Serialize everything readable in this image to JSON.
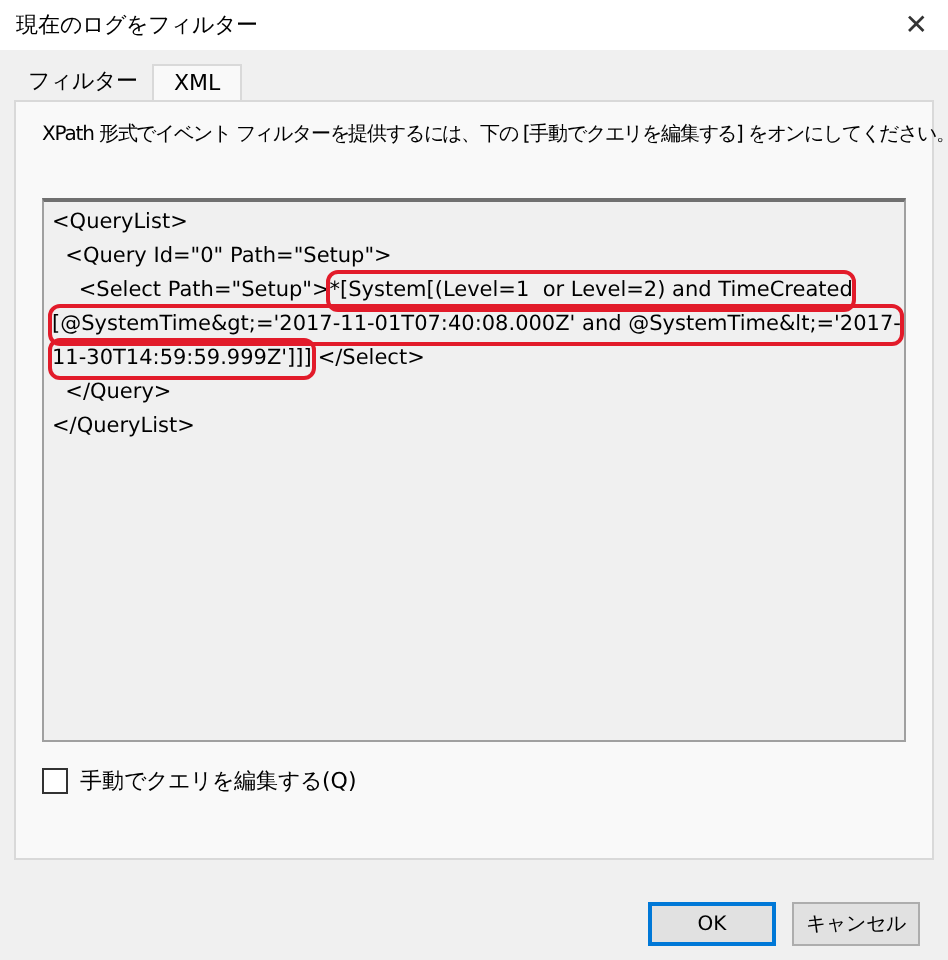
{
  "window": {
    "title": "現在のログをフィルター",
    "close": "✕"
  },
  "tabs": [
    {
      "label": "フィルター",
      "selected": false
    },
    {
      "label": "XML",
      "selected": true
    }
  ],
  "description": "XPath 形式でイベント フィルターを提供するには、下の [手動でクエリを編集する] をオンにしてください。",
  "xml_lines": [
    [
      {
        "text": "<QueryList>",
        "highlighted": false
      }
    ],
    [
      {
        "text": "  <Query Id=\"0\" Path=\"Setup\">",
        "highlighted": false
      }
    ],
    [
      {
        "text": "    <Select Path=\"Setup\">",
        "highlighted": false
      },
      {
        "text": "*[System[(Level=1  or Level=2) and TimeCreated",
        "highlighted": true
      }
    ],
    [
      {
        "text": "[@SystemTime&gt;='2017-11-01T07:40:08.000Z' and @SystemTime&lt;='2017-",
        "highlighted": true
      }
    ],
    [
      {
        "text": "11-30T14:59:59.999Z']]]",
        "highlighted": true
      },
      {
        "text": "</Select>",
        "highlighted": false
      }
    ],
    [
      {
        "text": "  </Query>",
        "highlighted": false
      }
    ],
    [
      {
        "text": "</QueryList>",
        "highlighted": false
      }
    ]
  ],
  "manual_edit": {
    "label": "手動でクエリを編集する(Q)",
    "checked": false
  },
  "buttons": [
    {
      "label": "OK",
      "default": true
    },
    {
      "label": "キャンセル",
      "default": false
    }
  ]
}
